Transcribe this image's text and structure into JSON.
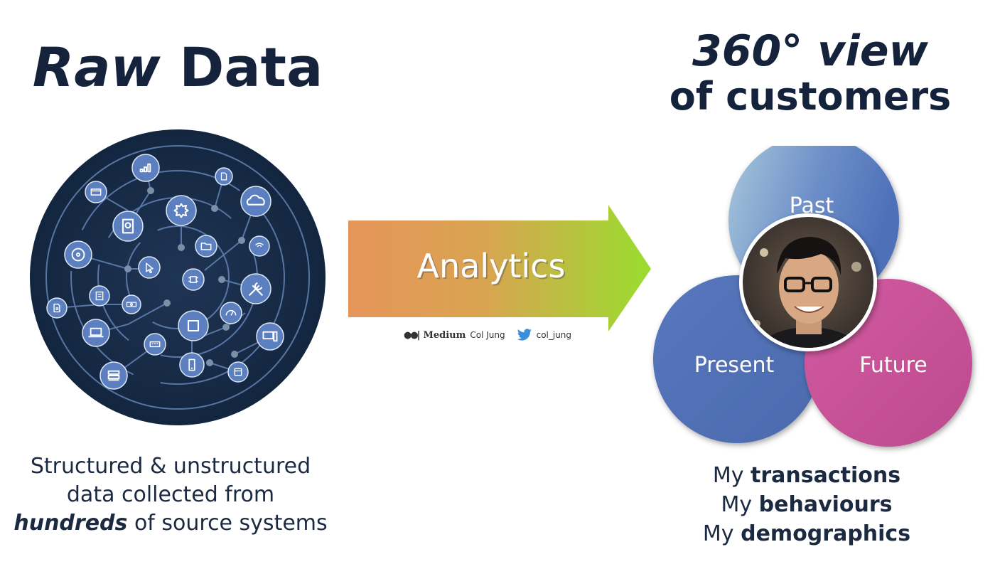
{
  "left": {
    "title_em": "Raw",
    "title_rest": "Data",
    "caption_line1": "Structured & unstructured",
    "caption_line2": "data collected from",
    "caption_line3_em": "hundreds",
    "caption_line3_rest": "of source systems"
  },
  "arrow": {
    "label": "Analytics",
    "gradient": [
      "#e6955a",
      "#99dd2e"
    ]
  },
  "credit": {
    "medium_label": "Medium",
    "medium_user": "Col Jung",
    "twitter_user": "col_jung"
  },
  "right": {
    "title_line1": "360° view",
    "title_line2": "of customers",
    "circles": {
      "past": "Past",
      "present": "Present",
      "future": "Future"
    },
    "colors": {
      "past": "#5b7fbf",
      "present": "#4e69ad",
      "future": "#c64d93"
    },
    "captions": [
      {
        "prefix": "My",
        "bold": "transactions"
      },
      {
        "prefix": "My",
        "bold": "behaviours"
      },
      {
        "prefix": "My",
        "bold": "demographics"
      }
    ]
  },
  "network_icons": [
    "bar-chart-icon",
    "credit-card-icon",
    "sd-card-icon",
    "hard-drive-icon",
    "gear-icon",
    "cloud-icon",
    "disc-icon",
    "folder-icon",
    "wifi-icon",
    "cursor-icon",
    "chip-icon",
    "tools-icon",
    "document-icon",
    "server-board-icon",
    "money-icon",
    "speedometer-icon",
    "laptop-icon",
    "tablet-icon",
    "desktop-icon",
    "keyboard-icon",
    "phone-icon",
    "database-icon",
    "windows-icon"
  ]
}
